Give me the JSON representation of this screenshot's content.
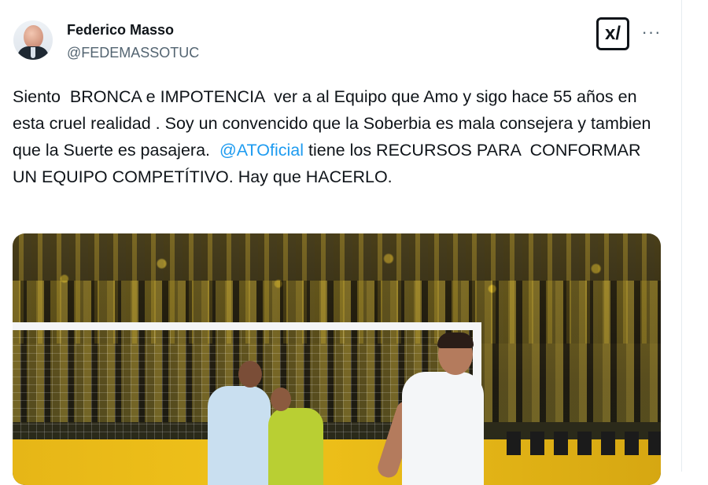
{
  "tweet": {
    "author": {
      "display_name": "Federico Masso",
      "handle": "@FEDEMASSOTUC",
      "avatar_icon": "user-avatar-photo"
    },
    "header_actions": {
      "grok_icon": "x-grok-logo-icon",
      "grok_label": "x/",
      "more_icon": "more-dots-icon",
      "more_label": "···"
    },
    "text": {
      "before_mention": "Siento  BRONCA e IMPOTENCIA  ver a al Equipo que Amo y sigo hace 55 años en esta cruel realidad . Soy un convencido que la Soberbia es mala consejera y tambien que la Suerte es pasajera.  ",
      "mention": "@ATOficial",
      "after_mention": " tiene los RECURSOS PARA  CONFORMAR UN EQUIPO COMPETÍTIVO. Hay que HACERLO."
    },
    "media": {
      "type": "photo",
      "description_icon": "football-match-photo"
    }
  },
  "colors": {
    "text": "#0f1419",
    "secondary_text": "#536471",
    "link": "#1d9bf0",
    "divider": "#e6ecf0"
  }
}
